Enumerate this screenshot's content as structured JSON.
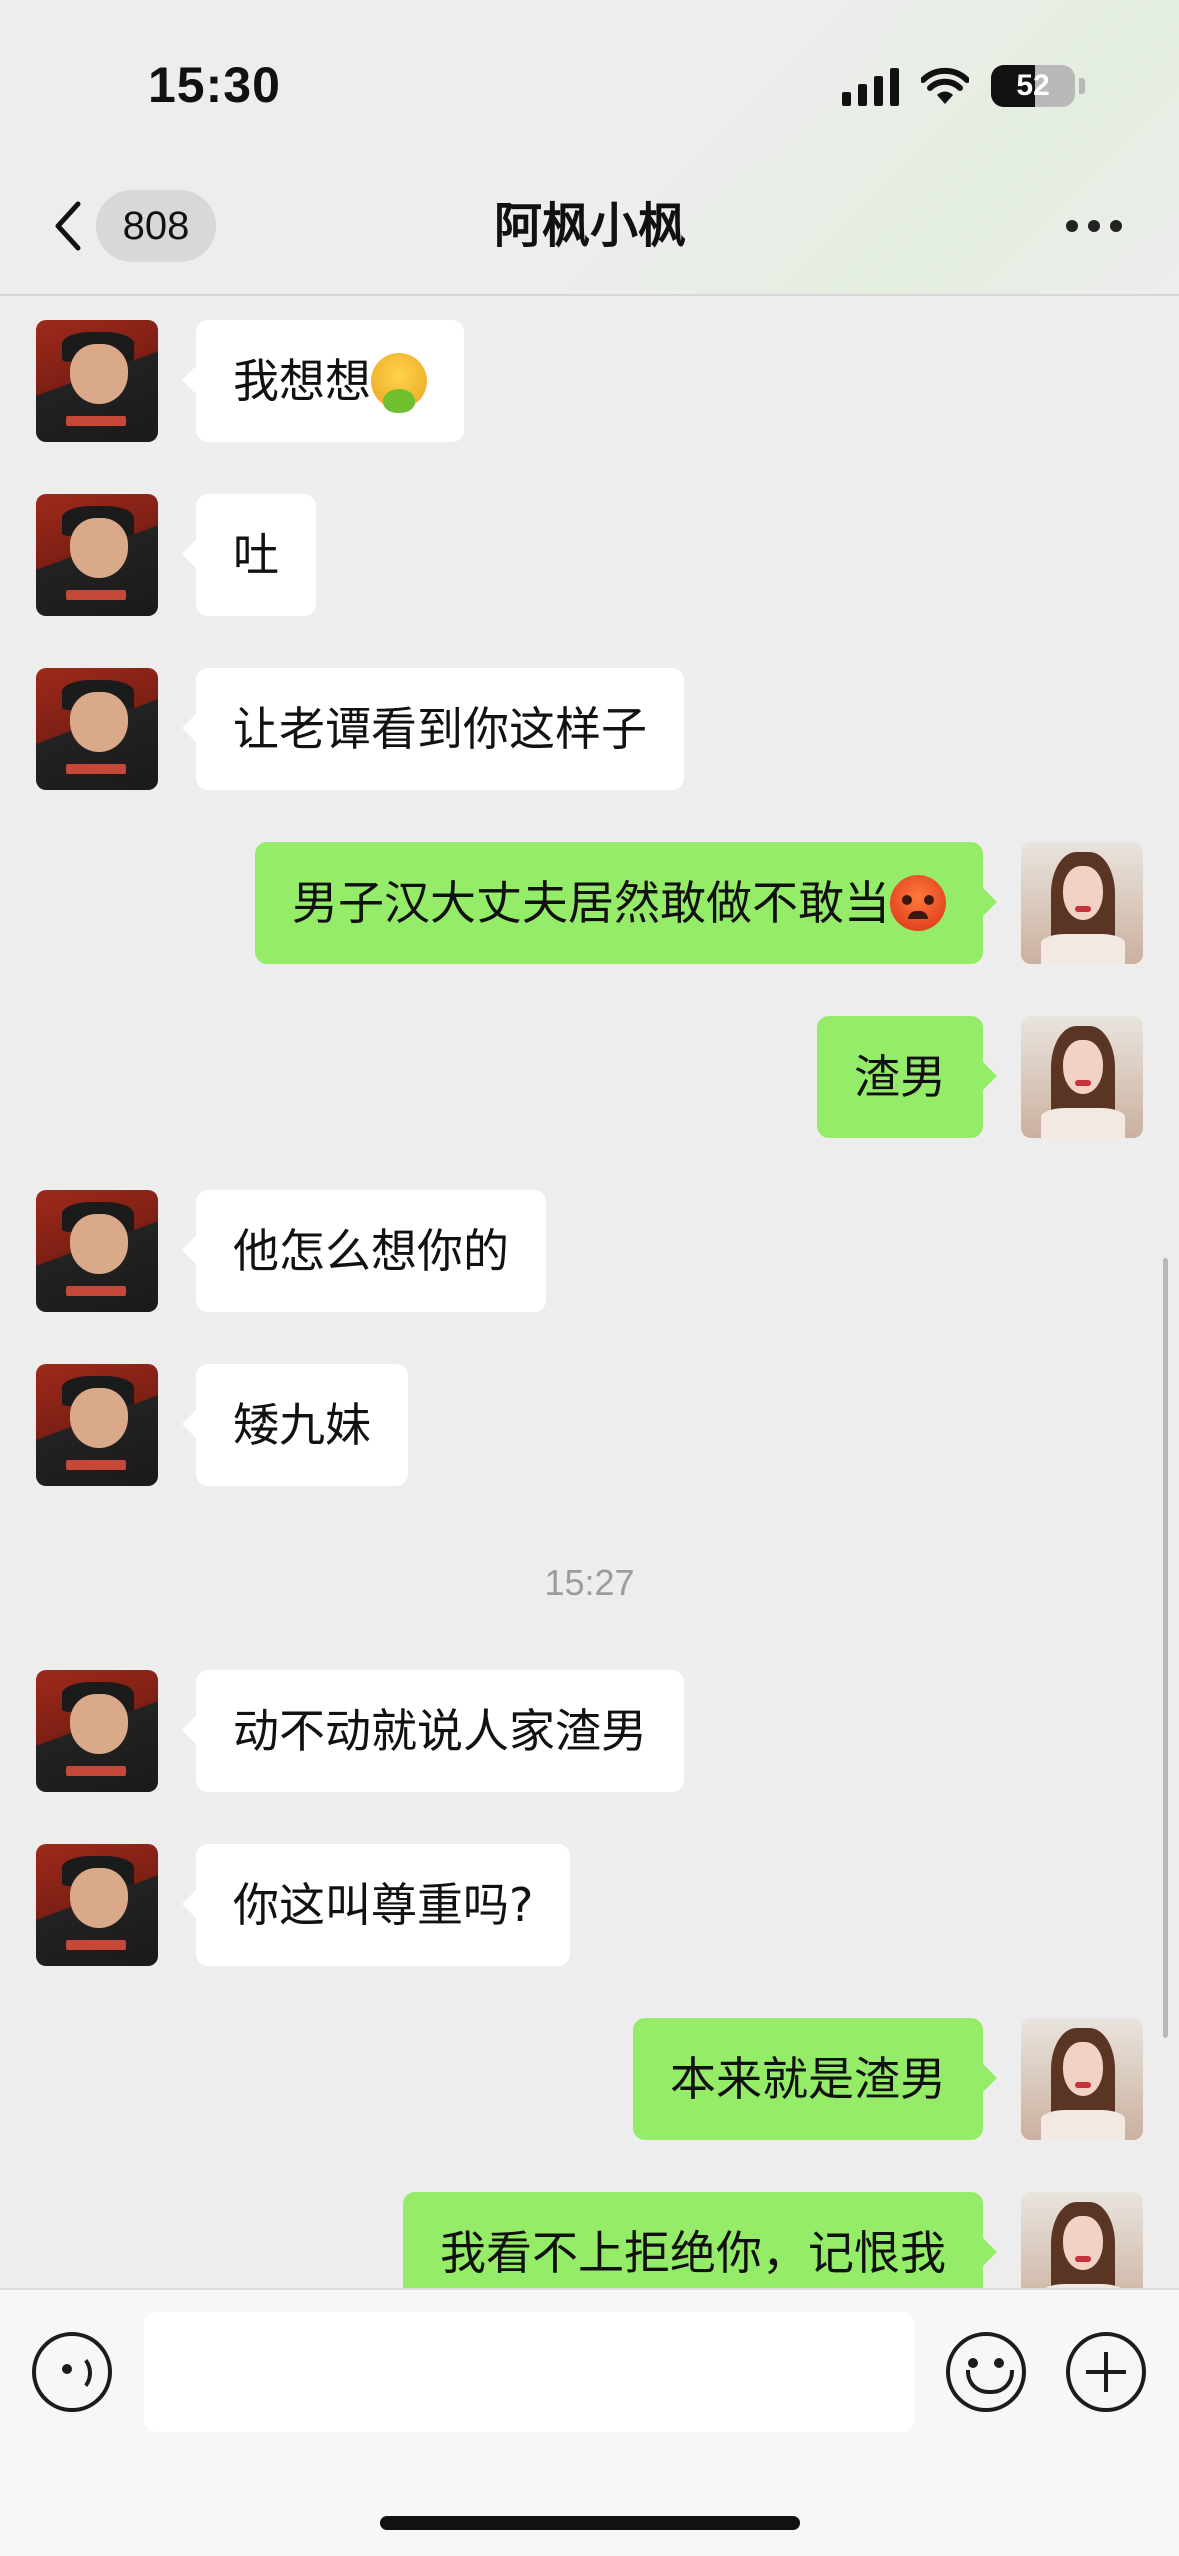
{
  "status_bar": {
    "time": "15:30",
    "battery": "52"
  },
  "nav": {
    "back_badge": "808",
    "title": "阿枫小枫"
  },
  "messages": [
    {
      "side": "left",
      "text": "我想想",
      "emoji": "nauseated-face"
    },
    {
      "side": "left",
      "text": "吐"
    },
    {
      "side": "left",
      "text": "让老谭看到你这样子"
    },
    {
      "side": "right",
      "text": "男子汉大丈夫居然敢做不敢当",
      "emoji": "angry-face"
    },
    {
      "side": "right",
      "text": "渣男"
    },
    {
      "side": "left",
      "text": "他怎么想你的"
    },
    {
      "side": "left",
      "text": "矮九妹"
    },
    {
      "side": "left",
      "text": "动不动就说人家渣男"
    },
    {
      "side": "left",
      "text": "你这叫尊重吗?"
    },
    {
      "side": "right",
      "text": "本来就是渣男"
    },
    {
      "side": "right",
      "text": "我看不上拒绝你，记恨我"
    }
  ],
  "timestamp": "15:27",
  "input": {
    "value": ""
  },
  "colors": {
    "background": "#ededed",
    "bubble_out": "#95ec69",
    "bubble_in": "#ffffff"
  }
}
